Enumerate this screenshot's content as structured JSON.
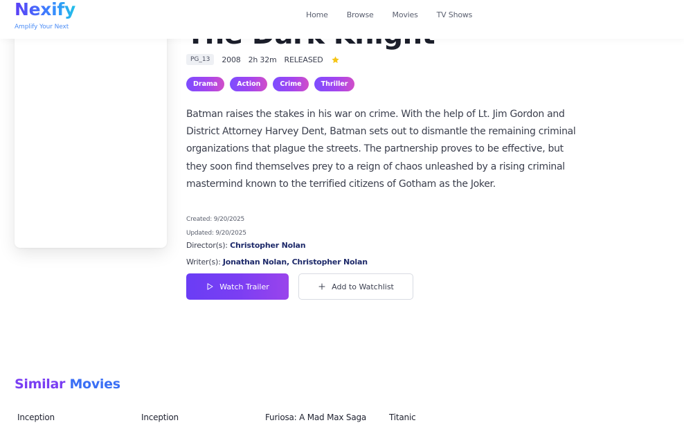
{
  "header": {
    "logo": "Nexify",
    "tagline": "Amplify Your Next",
    "nav": [
      "Home",
      "Browse",
      "Movies",
      "TV Shows"
    ]
  },
  "movie": {
    "title": "The Dark Knight",
    "rating": "PG_13",
    "year": "2008",
    "runtime": "2h 32m",
    "status": "RELEASED",
    "genres": [
      "Drama",
      "Action",
      "Crime",
      "Thriller"
    ],
    "overview": "Batman raises the stakes in his war on crime. With the help of Lt. Jim Gordon and District Attorney Harvey Dent, Batman sets out to dismantle the remaining criminal organizations that plague the streets. The partnership proves to be effective, but they soon find themselves prey to a reign of chaos unleashed by a rising criminal mastermind known to the terrified citizens of Gotham as the Joker.",
    "created": "Created: 9/20/2025",
    "updated": "Updated: 9/20/2025",
    "director_label": "Director(s):",
    "directors": "Christopher Nolan",
    "writer_label": "Writer(s):",
    "writers": "Jonathan Nolan, Christopher Nolan"
  },
  "actions": {
    "trailer": "Watch Trailer",
    "watchlist": "Add to Watchlist"
  },
  "similar": {
    "title_part1": "Similar",
    "title_part2": "Movies",
    "items": [
      "Inception",
      "Inception",
      "Furiosa: A Mad Max Saga",
      "Titanic"
    ]
  },
  "colors": {
    "accent_purple": "#7a3ef3",
    "accent_blue": "#3a6ff5",
    "star": "#f5c518"
  },
  "icons": {
    "star": "star-icon",
    "play": "play-icon",
    "plus": "plus-icon"
  }
}
